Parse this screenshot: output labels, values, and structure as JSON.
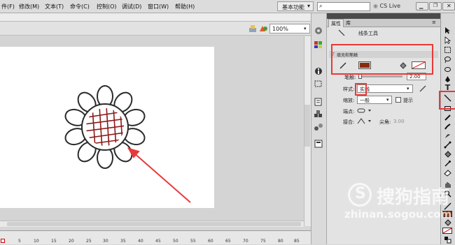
{
  "menu": [
    "件(F)",
    "修改(M)",
    "文本(T)",
    "命令(C)",
    "控制(O)",
    "调试(D)",
    "窗口(W)",
    "帮助(H)"
  ],
  "workspace_label": "基本功能",
  "search_placeholder": "",
  "cs_live": "CS Live",
  "zoom_value": "100%",
  "timeline_ticks": [
    "5",
    "10",
    "15",
    "20",
    "25",
    "30",
    "35",
    "40",
    "45",
    "50",
    "55",
    "60",
    "65",
    "70",
    "75",
    "80",
    "85",
    "90"
  ],
  "panel": {
    "tab_properties": "属性",
    "tab_library": "库",
    "tool_name": "线条工具",
    "section_fill_stroke": "填充和笔触",
    "stroke_label": "笔触:",
    "stroke_value": "2.00",
    "style_label": "样式:",
    "style_value": "实线",
    "scale_label": "缩放:",
    "scale_value": "一般",
    "hint_label": "提示",
    "cap_label": "端点:",
    "join_label": "接合:",
    "miter_label": "尖角:",
    "miter_value": "3.00"
  },
  "colors": {
    "accent_red": "#e8393a",
    "fill_color": "#8b2b0c",
    "hatch_color": "#8b1a1a"
  },
  "watermark": {
    "brand": "搜狗指南",
    "url": "zhinan.sogou.com"
  },
  "icons": [
    "arrow-icon",
    "subselect-icon",
    "free-transform-icon",
    "lasso-icon",
    "pen-icon",
    "text-icon",
    "line-icon",
    "rectangle-icon",
    "pencil-icon",
    "brush-icon",
    "deco-icon",
    "bone-icon",
    "paint-bucket-icon",
    "eyedropper-icon",
    "eraser-icon",
    "hand-icon",
    "zoom-icon"
  ]
}
